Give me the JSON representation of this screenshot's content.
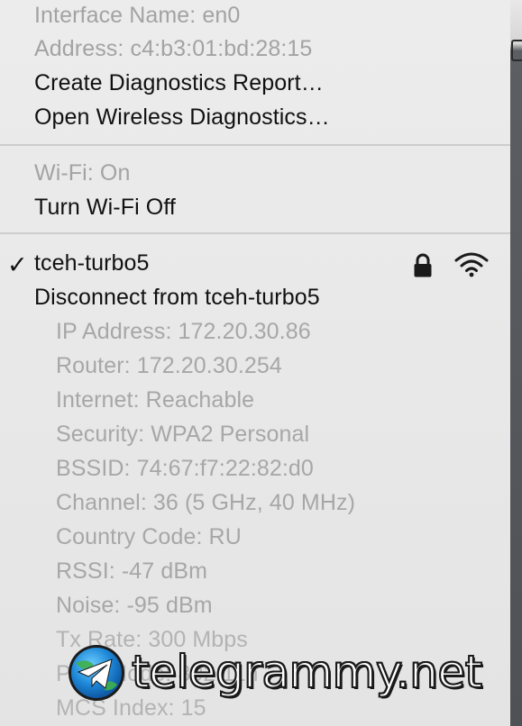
{
  "menu": {
    "interface_info": {
      "interface_name": "Interface Name: en0",
      "address": "Address: c4:b3:01:bd:28:15"
    },
    "actions": {
      "create_report": "Create Diagnostics Report…",
      "open_diagnostics": "Open Wireless Diagnostics…"
    },
    "wifi": {
      "status": "Wi-Fi: On",
      "toggle": "Turn Wi-Fi Off"
    },
    "network": {
      "checkmark": "✓",
      "name": "tceh-turbo5",
      "disconnect": "Disconnect from tceh-turbo5",
      "lock_icon": "lock-icon",
      "signal_icon": "wifi-signal-icon",
      "details": [
        "IP Address: 172.20.30.86",
        "Router: 172.20.30.254",
        "Internet: Reachable",
        "Security: WPA2 Personal",
        "BSSID: 74:67:f7:22:82:d0",
        "Channel: 36 (5 GHz, 40 MHz)",
        "Country Code: RU",
        "RSSI: -47 dBm",
        "Noise: -95 dBm",
        "Tx Rate: 300 Mbps",
        "PHY Mode: 802.11n",
        "MCS Index: 15"
      ]
    }
  },
  "watermark": {
    "text": "telegrammy.net",
    "icon": "telegram-logo-icon"
  },
  "colors": {
    "menu_bg": "#ececec",
    "text_enabled": "#111111",
    "text_disabled": "#a3a3a3",
    "separator": "#cdcdcd"
  }
}
